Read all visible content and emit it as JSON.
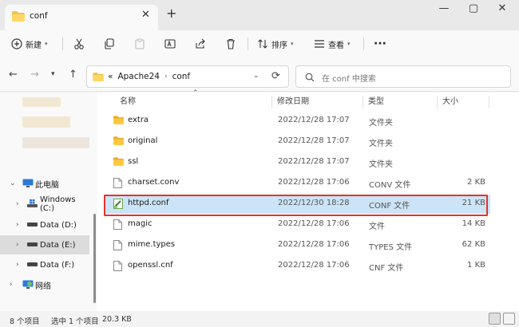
{
  "window": {
    "tab_title": "conf",
    "new_tab": "+",
    "close_tab": "✕",
    "minimize": "—",
    "maximize": "▢",
    "close": "✕"
  },
  "toolbar": {
    "new_label": "新建",
    "sort_label": "排序",
    "view_label": "查看",
    "more": "···"
  },
  "address": {
    "overflow": "«",
    "crumbs": [
      "Apache24",
      "conf"
    ]
  },
  "search": {
    "placeholder": "在 conf 中搜索"
  },
  "nav": {
    "items": [
      {
        "label": "此电脑",
        "icon": "computer-icon"
      },
      {
        "label": "Windows (C:)",
        "icon": "windows-drive-icon"
      },
      {
        "label": "Data (D:)",
        "icon": "drive-icon"
      },
      {
        "label": "Data (E:)",
        "icon": "drive-icon",
        "selected": true
      },
      {
        "label": "Data (F:)",
        "icon": "drive-icon"
      },
      {
        "label": "网络",
        "icon": "network-icon"
      }
    ]
  },
  "columns": {
    "name": "名称",
    "date": "修改日期",
    "type": "类型",
    "size": "大小"
  },
  "files": [
    {
      "name": "extra",
      "date": "2022/12/28 17:07",
      "type": "文件夹",
      "size": "",
      "icon": "folder-icon"
    },
    {
      "name": "original",
      "date": "2022/12/28 17:07",
      "type": "文件夹",
      "size": "",
      "icon": "folder-icon"
    },
    {
      "name": "ssl",
      "date": "2022/12/28 17:07",
      "type": "文件夹",
      "size": "",
      "icon": "folder-icon"
    },
    {
      "name": "charset.conv",
      "date": "2022/12/28 17:06",
      "type": "CONV 文件",
      "size": "2 KB",
      "icon": "file-icon"
    },
    {
      "name": "httpd.conf",
      "date": "2022/12/30 18:28",
      "type": "CONF 文件",
      "size": "21 KB",
      "icon": "notepad-file-icon",
      "selected": true
    },
    {
      "name": "magic",
      "date": "2022/12/28 17:06",
      "type": "文件",
      "size": "14 KB",
      "icon": "file-icon"
    },
    {
      "name": "mime.types",
      "date": "2022/12/28 17:06",
      "type": "TYPES 文件",
      "size": "62 KB",
      "icon": "file-icon"
    },
    {
      "name": "openssl.cnf",
      "date": "2022/12/28 17:06",
      "type": "CNF 文件",
      "size": "1 KB",
      "icon": "file-icon"
    }
  ],
  "status": {
    "count": "8 个项目",
    "selection": "选中 1 个项目",
    "size": "20.3 KB"
  },
  "colors": {
    "accent": "#0067c0",
    "selection": "#cce4f7",
    "highlight_border": "#e0352b",
    "folder": "#f4c24d"
  }
}
